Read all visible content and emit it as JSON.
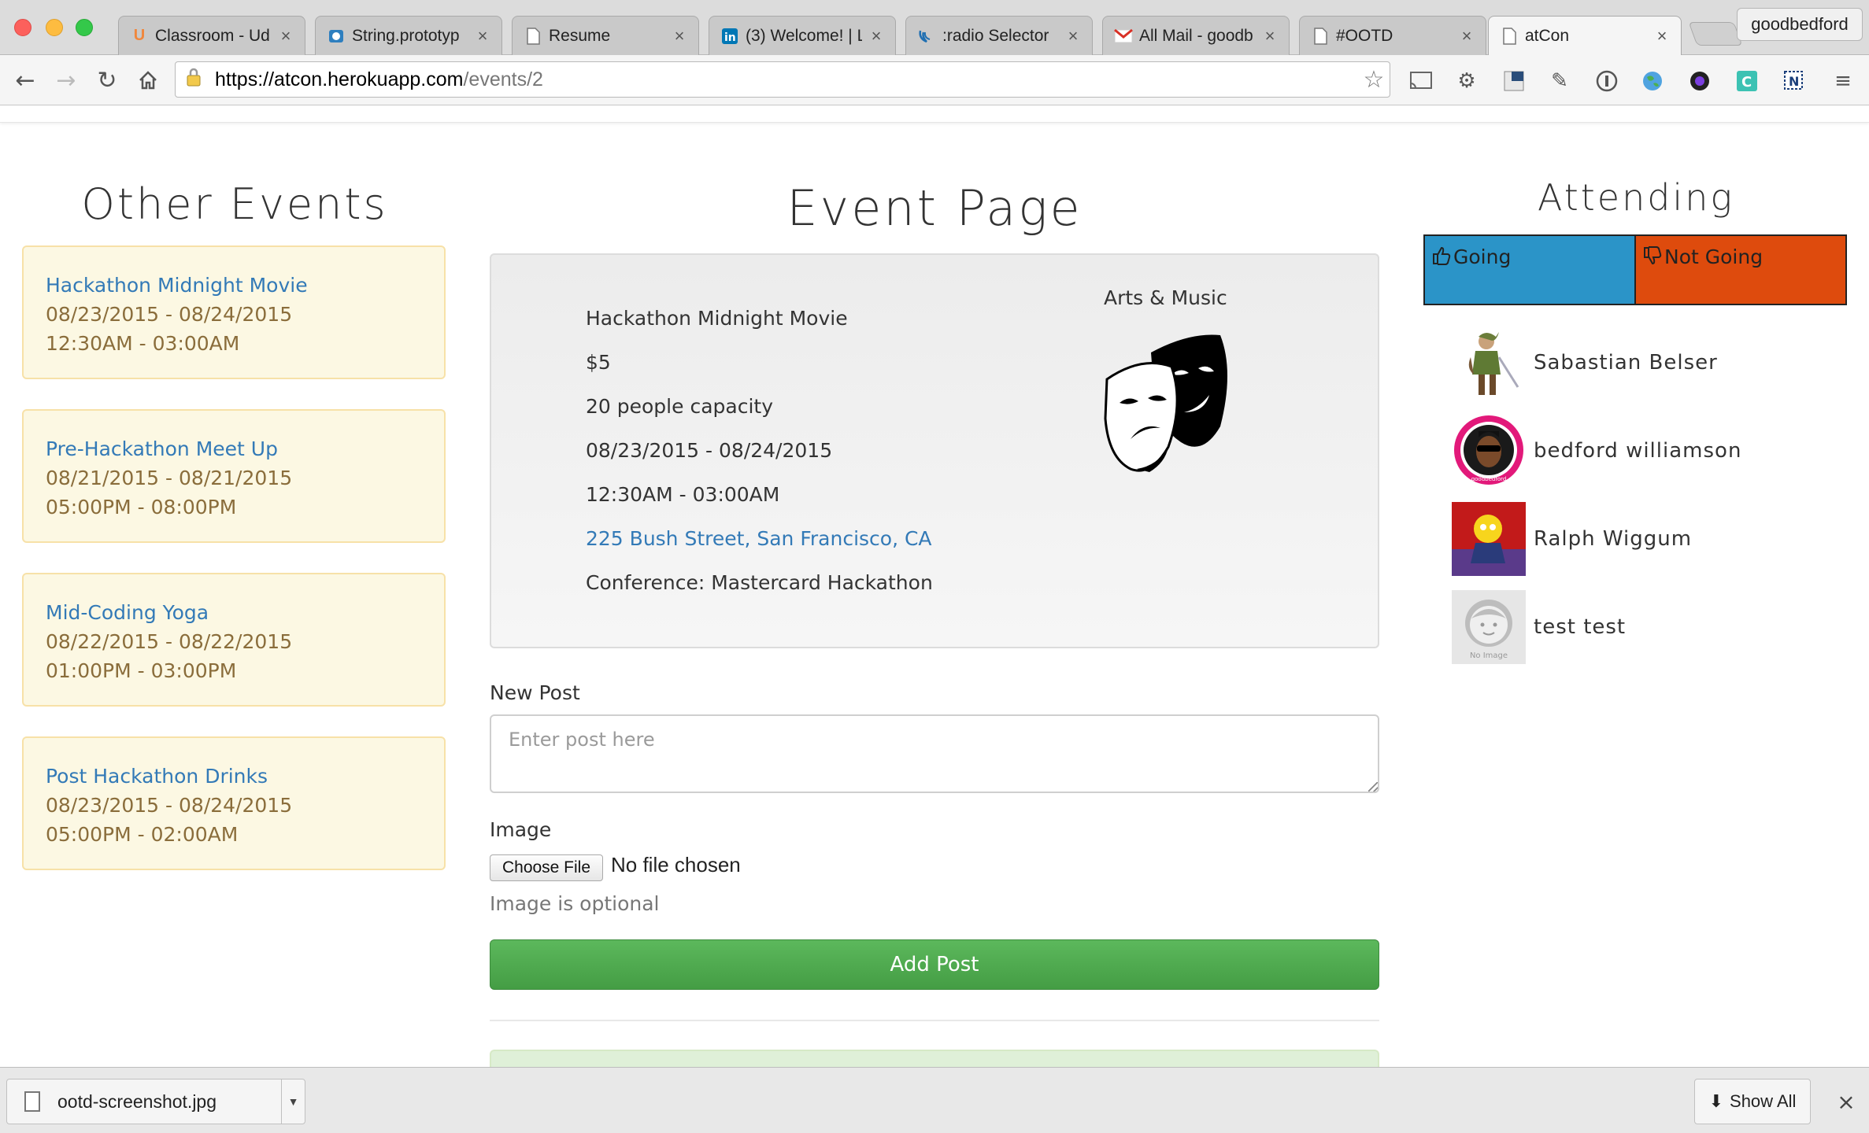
{
  "browser": {
    "tabs": [
      {
        "label": "Classroom - Ud",
        "icon": "udacity-icon"
      },
      {
        "label": "String.prototyp",
        "icon": "mdn-icon"
      },
      {
        "label": "Resume",
        "icon": "page-icon"
      },
      {
        "label": "(3) Welcome! | L",
        "icon": "linkedin-icon"
      },
      {
        "label": ":radio Selector",
        "icon": "jquery-icon"
      },
      {
        "label": "All Mail - goodb",
        "icon": "gmail-icon"
      },
      {
        "label": "#OOTD",
        "icon": "page-icon"
      },
      {
        "label": "atCon",
        "icon": "page-icon",
        "active": true
      }
    ],
    "tab_close": "×",
    "profile": "goodbedford",
    "url_host": "https://atcon.herokuapp.com",
    "url_path": "/events/2"
  },
  "page": {
    "other_events_heading": "Other Events",
    "event_page_heading": "Event Page",
    "attending_heading": "Attending",
    "other_events": [
      {
        "title": "Hackathon Midnight Movie",
        "dates": "08/23/2015 - 08/24/2015",
        "times": "12:30AM - 03:00AM"
      },
      {
        "title": "Pre-Hackathon Meet Up",
        "dates": "08/21/2015 - 08/21/2015",
        "times": "05:00PM - 08:00PM"
      },
      {
        "title": "Mid-Coding Yoga",
        "dates": "08/22/2015 - 08/22/2015",
        "times": "01:00PM - 03:00PM"
      },
      {
        "title": "Post Hackathon Drinks",
        "dates": "08/23/2015 - 08/24/2015",
        "times": "05:00PM - 02:00AM"
      }
    ],
    "event": {
      "name": "Hackathon Midnight Movie",
      "price": "$5",
      "capacity": "20 people capacity",
      "dates": "08/23/2015 - 08/24/2015",
      "times": "12:30AM - 03:00AM",
      "address": "225 Bush Street, San Francisco, CA",
      "conference": "Conference: Mastercard Hackathon",
      "category": "Arts & Music"
    },
    "form": {
      "new_post_label": "New Post",
      "post_placeholder": "Enter post here",
      "image_label": "Image",
      "choose_file": "Choose File",
      "no_file": "No file chosen",
      "image_help": "Image is optional",
      "add_post": "Add Post"
    },
    "rsvp": {
      "going": "Going",
      "not_going": "Not Going"
    },
    "attendees": [
      {
        "name": "Sabastian Belser"
      },
      {
        "name": "bedford williamson"
      },
      {
        "name": "Ralph Wiggum"
      },
      {
        "name": "test test"
      }
    ],
    "no_image_text": "No Image",
    "avatar_badge": "goodbedford"
  },
  "download_shelf": {
    "file": "ootd-screenshot.jpg",
    "show_all": "Show All",
    "close": "×"
  },
  "colors": {
    "going": "#2b94c8",
    "not_going": "#de4b0d",
    "add_post": "#4cae4c",
    "link": "#337ab7",
    "card_bg": "#fcf8e3",
    "card_text": "#8a6d3b"
  }
}
